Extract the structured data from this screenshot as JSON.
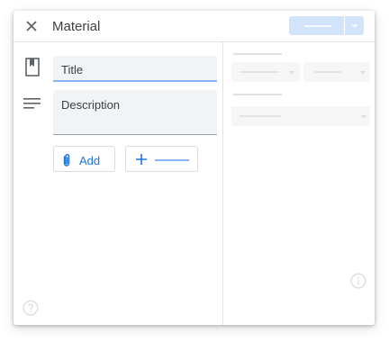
{
  "dialog": {
    "title": "Material",
    "close_icon": "close-icon",
    "primary_button_color": "#d2e3fc"
  },
  "form": {
    "title_field": {
      "label": "Title"
    },
    "description_field": {
      "label": "Description"
    },
    "attachment_icon": "bookmark-icon",
    "description_icon": "notes-icon",
    "add_button": {
      "label": "Add",
      "icon": "paperclip-icon"
    },
    "create_button": {
      "icon": "plus-icon"
    }
  },
  "footer": {
    "help_icon": "help-circle-icon",
    "info_icon": "info-circle-icon"
  },
  "colors": {
    "accent": "#1a73e8",
    "focus_underline": "#8ab4f8",
    "field_background": "#f1f3f4"
  }
}
